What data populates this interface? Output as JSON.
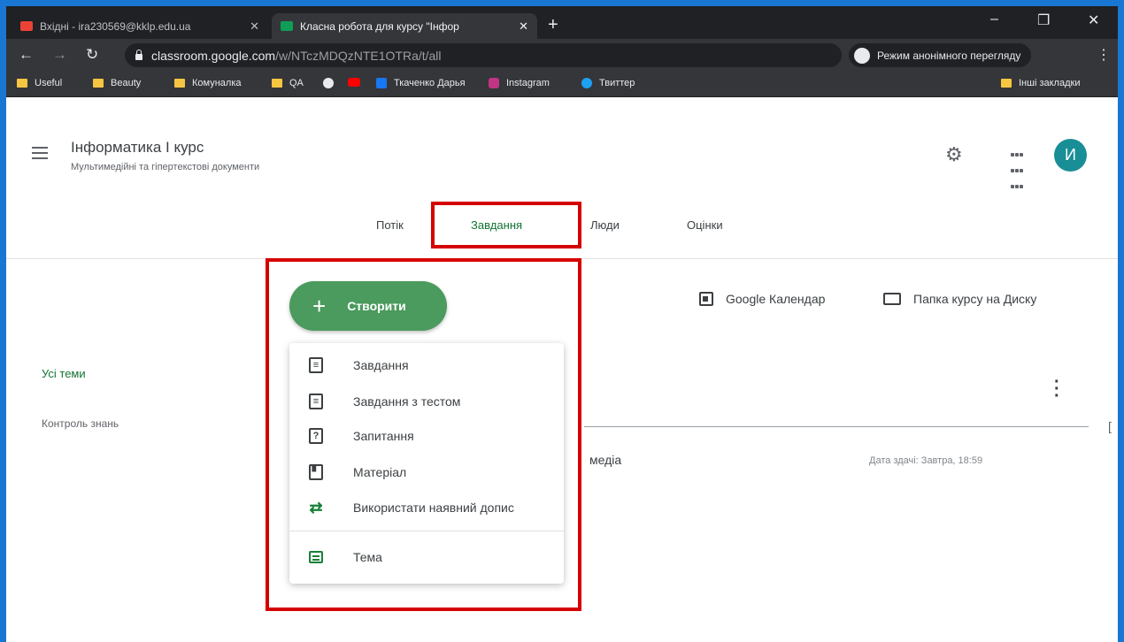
{
  "browser": {
    "tabs": [
      {
        "title": "Вхідні - ira230569@kklp.edu.ua",
        "favicon_color": "#ea4335"
      },
      {
        "title": "Класна робота для курсу \"Інфор",
        "favicon_color": "#0f9d58"
      }
    ],
    "new_tab": "+",
    "window_controls": {
      "minimize": "–",
      "restore": "❐",
      "close": "✕"
    },
    "url_host": "classroom.google.com",
    "url_path": "/w/NTczMDQzNTE1OTRa/t/all",
    "incognito_label": "Режим анонімного перегляду",
    "bookmarks": [
      {
        "label": "Useful",
        "icon": "folder-icon"
      },
      {
        "label": "Beauty",
        "icon": "folder-icon"
      },
      {
        "label": "Комуналка",
        "icon": "folder-icon"
      },
      {
        "label": "QA",
        "icon": "folder-icon"
      },
      {
        "label": "",
        "icon": "google-icon"
      },
      {
        "label": "",
        "icon": "youtube-icon"
      },
      {
        "label": "Ткаченко Дарья",
        "icon": "facebook-icon"
      },
      {
        "label": "Instagram",
        "icon": "instagram-icon"
      },
      {
        "label": "Твиттер",
        "icon": "twitter-icon"
      }
    ],
    "other_bookmarks": "Інші закладки"
  },
  "header": {
    "course_title": "Інформатика І курс",
    "course_subtitle": "Мультимедійні та гіпертекстові документи",
    "avatar_letter": "И"
  },
  "nav_tabs": [
    {
      "label": "Потік",
      "active": false
    },
    {
      "label": "Завдання",
      "active": true
    },
    {
      "label": "Люди",
      "active": false
    },
    {
      "label": "Оцінки",
      "active": false
    }
  ],
  "create": {
    "label": "Створити",
    "items": [
      {
        "label": "Завдання",
        "icon": "assignment-icon"
      },
      {
        "label": "Завдання з тестом",
        "icon": "quiz-assignment-icon"
      },
      {
        "label": "Запитання",
        "icon": "question-icon"
      },
      {
        "label": "Матеріал",
        "icon": "material-icon"
      },
      {
        "label": "Використати наявний допис",
        "icon": "reuse-post-icon"
      }
    ],
    "topic_item": {
      "label": "Тема",
      "icon": "topic-icon"
    }
  },
  "links": {
    "calendar": "Google Календар",
    "drive_folder": "Папка курсу на Диску"
  },
  "topics": {
    "all": "Усі теми",
    "items": [
      "Контроль знань"
    ]
  },
  "task": {
    "title_fragment": "медіа",
    "due": "Дата здачі: Завтра, 18:59"
  },
  "colors": {
    "frame": "#1976d2",
    "highlight": "#d50000",
    "classroom_green": "#137333",
    "create_button": "#4b9a5e",
    "avatar": "#1a8e96"
  }
}
